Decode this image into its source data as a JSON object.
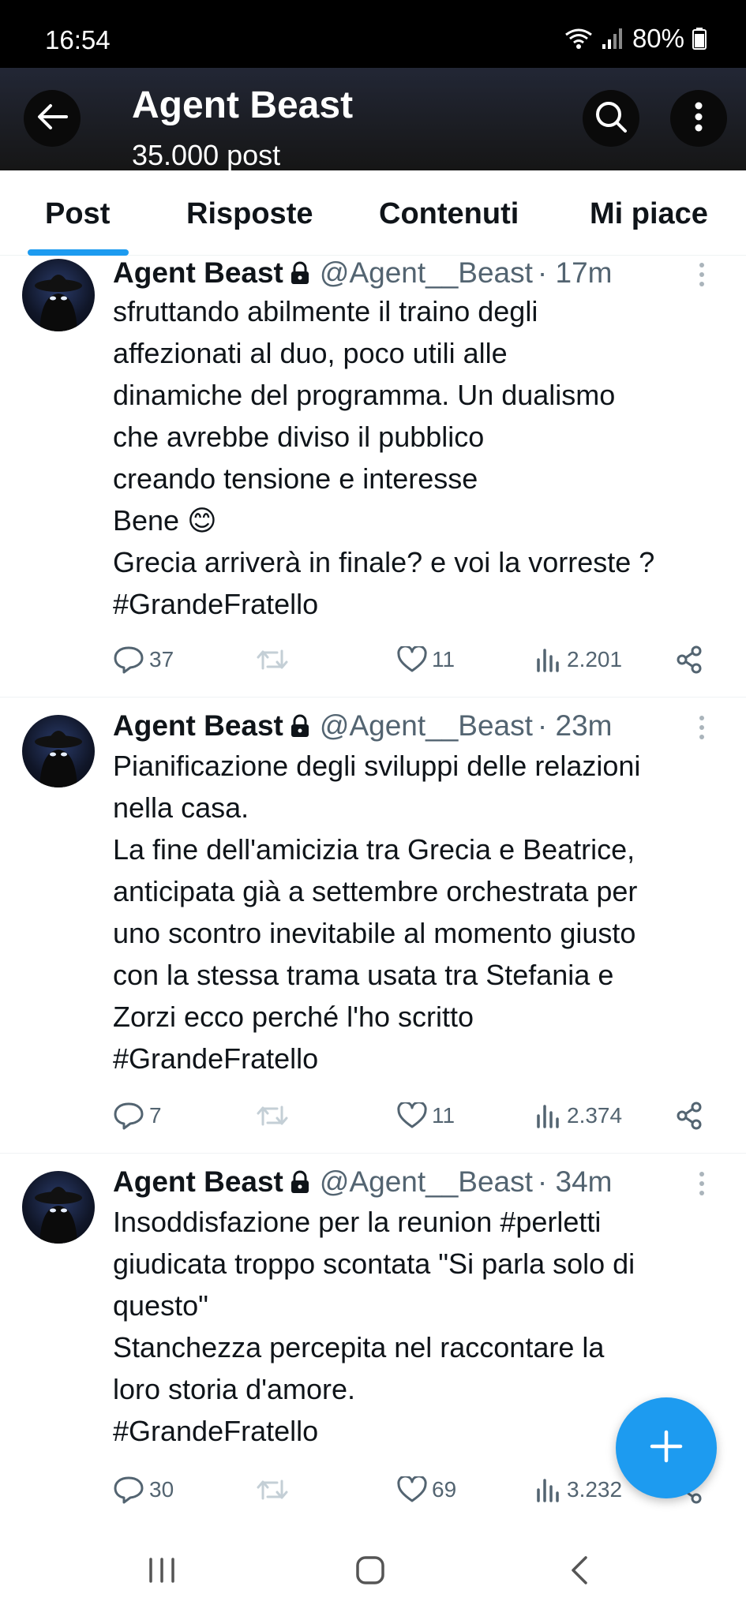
{
  "status": {
    "time": "16:54",
    "battery": "80%"
  },
  "header": {
    "title": "Agent Beast",
    "subtitle": "35.000 post"
  },
  "tabs": [
    {
      "label": "Post"
    },
    {
      "label": "Risposte"
    },
    {
      "label": "Contenuti"
    },
    {
      "label": "Mi piace"
    }
  ],
  "tweets": [
    {
      "name": "Agent Beast",
      "handle": "@Agent__Beast",
      "time": "· 17m",
      "text": "sfruttando abilmente il traino degli\naffezionati al duo, poco utili alle\ndinamiche del programma. Un dualismo\nche avrebbe diviso il pubblico\ncreando tensione e interesse\nBene 😊\nGrecia arriverà in finale? e voi la vorreste ?\n#GrandeFratello",
      "replies": "37",
      "reposts": "",
      "likes": "11",
      "views": "2.201"
    },
    {
      "name": "Agent Beast",
      "handle": "@Agent__Beast",
      "time": "· 23m",
      "text": "Pianificazione degli sviluppi delle relazioni\nnella casa.\nLa fine dell'amicizia tra Grecia e Beatrice,\nanticipata già a settembre orchestrata per\nuno scontro inevitabile al momento giusto\ncon la stessa trama usata tra Stefania e\nZorzi ecco perché l'ho scritto\n#GrandeFratello",
      "replies": "7",
      "reposts": "",
      "likes": "11",
      "views": "2.374"
    },
    {
      "name": "Agent Beast",
      "handle": "@Agent__Beast",
      "time": "· 34m",
      "text": "Insoddisfazione per la reunion #perletti\ngiudicata troppo scontata \"Si parla solo di\nquesto\"\nStanchezza percepita nel raccontare la\nloro storia d'amore.\n#GrandeFratello",
      "replies": "30",
      "reposts": "",
      "likes": "69",
      "views": "3.232"
    }
  ],
  "icons": {
    "back": "back-arrow-icon",
    "search": "search-icon",
    "more": "more-vertical-icon",
    "lock": "lock-icon",
    "reply": "reply-icon",
    "repost": "repost-icon",
    "like": "heart-icon",
    "views": "views-icon",
    "share": "share-icon",
    "compose": "plus-icon"
  },
  "colors": {
    "accent": "#1d9bf0",
    "text": "#0f1419",
    "muted": "#536471"
  }
}
